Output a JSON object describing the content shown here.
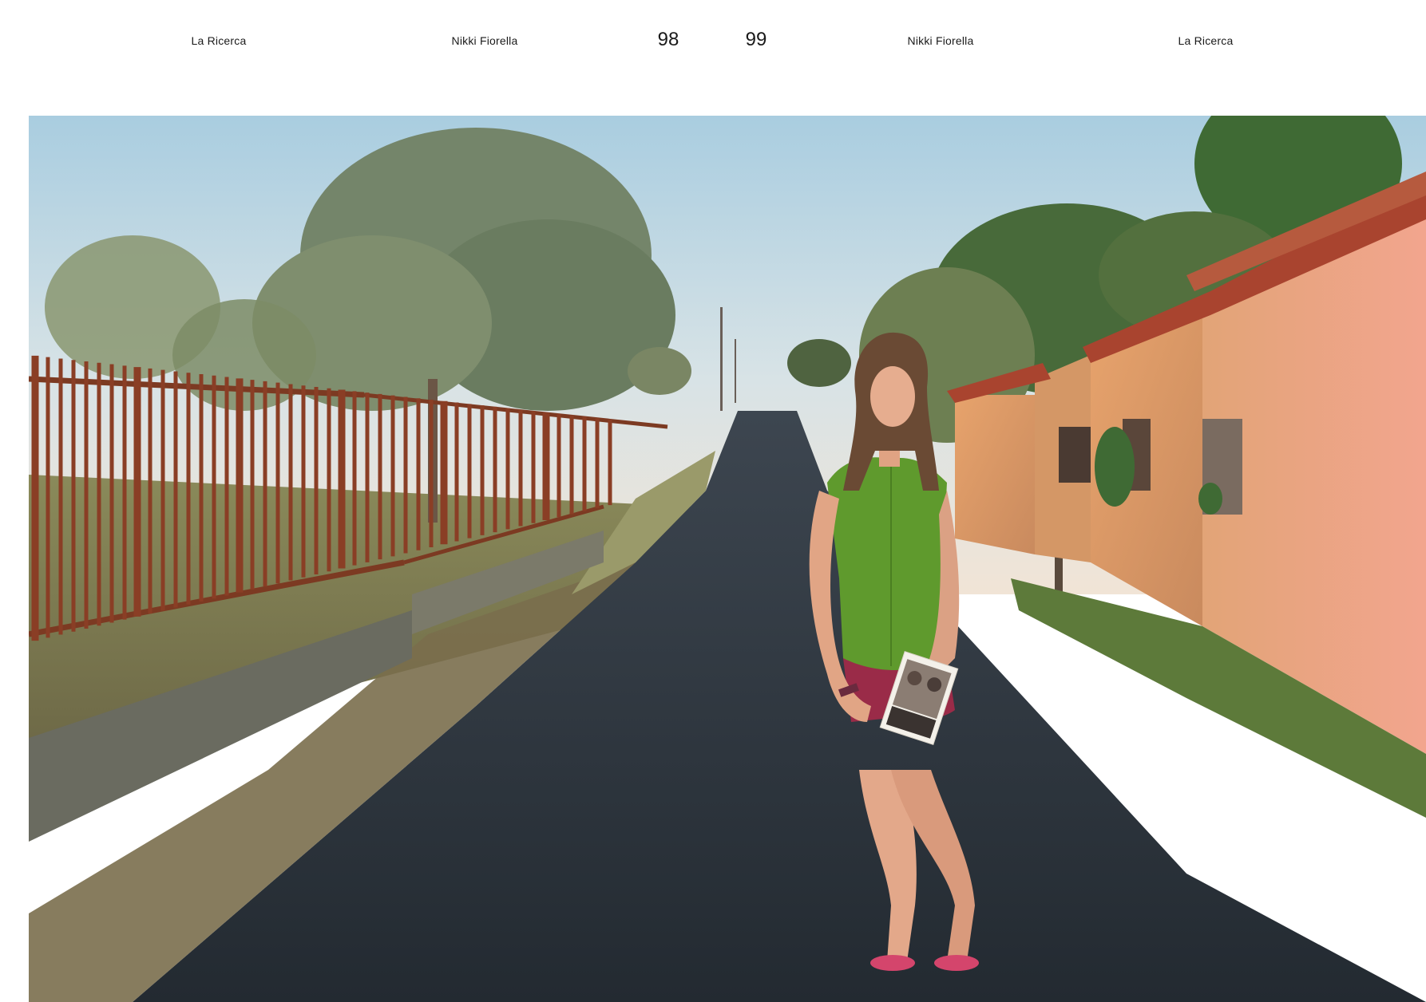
{
  "header": {
    "left_section": "La Ricerca",
    "left_author": "Nikki Fiorella",
    "page_left": "98",
    "page_right": "99",
    "right_author": "Nikki Fiorella",
    "right_section": "La Ricerca"
  },
  "photo": {
    "subject": "woman in green sleeveless blouse holding an old family photograph, standing on a narrow asphalt road between a rusty fence and stone houses at sunset"
  }
}
